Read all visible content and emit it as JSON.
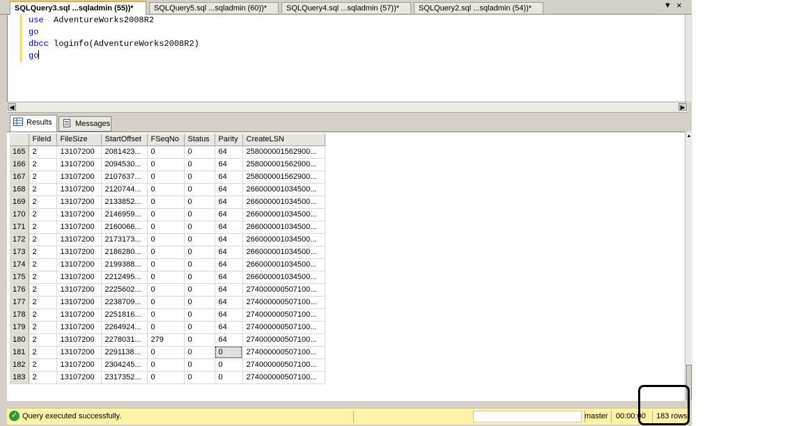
{
  "tabs": [
    {
      "label": "SQLQuery3.sql ...sqladmin (55))*",
      "active": true
    },
    {
      "label": "SQLQuery5.sql ...sqladmin (60))*",
      "active": false
    },
    {
      "label": "SQLQuery4.sql ...sqladmin (57))*",
      "active": false
    },
    {
      "label": "SQLQuery2.sql ...sqladmin (54))*",
      "active": false
    }
  ],
  "tab_controls": {
    "dropdown_glyph": "▼",
    "close_glyph": "×"
  },
  "editor": {
    "lines": [
      {
        "keyword": "use",
        "rest": "  AdventureWorks2008R2"
      },
      {
        "keyword": "go",
        "rest": ""
      },
      {
        "keyword": "dbcc",
        "rest": " loginfo(AdventureWorks2008R2)"
      },
      {
        "keyword": "go",
        "rest": ""
      }
    ]
  },
  "results": {
    "tabs": [
      {
        "label": "Results",
        "icon": "grid-icon"
      },
      {
        "label": "Messages",
        "icon": "document-icon"
      }
    ],
    "columns": [
      "FileId",
      "FileSize",
      "StartOffset",
      "FSeqNo",
      "Status",
      "Parity",
      "CreateLSN"
    ],
    "rows": [
      [
        "165",
        "2",
        "13107200",
        "2081423...",
        "0",
        "0",
        "64",
        "258000001562900..."
      ],
      [
        "166",
        "2",
        "13107200",
        "2094530...",
        "0",
        "0",
        "64",
        "258000001562900..."
      ],
      [
        "167",
        "2",
        "13107200",
        "2107637...",
        "0",
        "0",
        "64",
        "258000001562900..."
      ],
      [
        "168",
        "2",
        "13107200",
        "2120744...",
        "0",
        "0",
        "64",
        "266000001034500..."
      ],
      [
        "169",
        "2",
        "13107200",
        "2133852...",
        "0",
        "0",
        "64",
        "266000001034500..."
      ],
      [
        "170",
        "2",
        "13107200",
        "2146959...",
        "0",
        "0",
        "64",
        "266000001034500..."
      ],
      [
        "171",
        "2",
        "13107200",
        "2160066...",
        "0",
        "0",
        "64",
        "266000001034500..."
      ],
      [
        "172",
        "2",
        "13107200",
        "2173173...",
        "0",
        "0",
        "64",
        "266000001034500..."
      ],
      [
        "173",
        "2",
        "13107200",
        "2186280...",
        "0",
        "0",
        "64",
        "266000001034500..."
      ],
      [
        "174",
        "2",
        "13107200",
        "2199388...",
        "0",
        "0",
        "64",
        "266000001034500..."
      ],
      [
        "175",
        "2",
        "13107200",
        "2212495...",
        "0",
        "0",
        "64",
        "266000001034500..."
      ],
      [
        "176",
        "2",
        "13107200",
        "2225602...",
        "0",
        "0",
        "64",
        "274000000507100..."
      ],
      [
        "177",
        "2",
        "13107200",
        "2238709...",
        "0",
        "0",
        "64",
        "274000000507100..."
      ],
      [
        "178",
        "2",
        "13107200",
        "2251816...",
        "0",
        "0",
        "64",
        "274000000507100..."
      ],
      [
        "179",
        "2",
        "13107200",
        "2264924...",
        "0",
        "0",
        "64",
        "274000000507100..."
      ],
      [
        "180",
        "2",
        "13107200",
        "2278031...",
        "279",
        "0",
        "64",
        "274000000507100..."
      ],
      [
        "181",
        "2",
        "13107200",
        "2291138...",
        "0",
        "0",
        "0",
        "274000000507100..."
      ],
      [
        "182",
        "2",
        "13107200",
        "2304245...",
        "0",
        "0",
        "0",
        "274000000507100..."
      ],
      [
        "183",
        "2",
        "13107200",
        "2317352...",
        "0",
        "0",
        "0",
        "274000000507100..."
      ]
    ],
    "selected_cell": {
      "row": 16,
      "col": 6
    }
  },
  "status": {
    "message": "Query executed successfully.",
    "server": "",
    "user": "",
    "database": "master",
    "elapsed": "00:00:00",
    "rows": "183 rows",
    "icon": "success-check-icon",
    "bar_color": "#fdf3a6"
  }
}
